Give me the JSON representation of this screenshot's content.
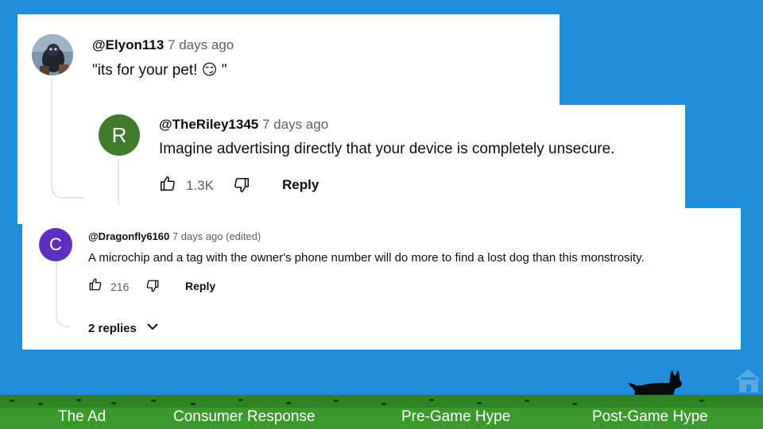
{
  "comments": [
    {
      "handle": "@Elyon113",
      "time": "7 days ago",
      "text": "\"its for your pet! 😏 \""
    },
    {
      "avatar_letter": "R",
      "avatar_color": "#3e7d2a",
      "handle": "@TheRiley1345",
      "time": "7 days ago",
      "text": "Imagine advertising directly that your device is completely unsecure.",
      "likes": "1.3K",
      "reply_label": "Reply"
    },
    {
      "avatar_letter": "C",
      "avatar_color": "#5b2fbf",
      "handle": "@Dragonfly6160",
      "time": "7 days ago (edited)",
      "text": "A microchip and a tag with the owner's phone number will do more to find a lost dog than this monstrosity.",
      "likes": "216",
      "reply_label": "Reply",
      "replies_label": "2 replies"
    }
  ],
  "nav": {
    "items": [
      "The Ad",
      "Consumer Response",
      "Pre-Game Hype",
      "Post-Game Hype"
    ]
  },
  "colors": {
    "background": "#1f8ed8",
    "grass": "#3c9a2c",
    "home_icon": "#5aa8e0"
  },
  "icons": [
    "thumbs-up-icon",
    "thumbs-down-icon",
    "chevron-down-icon",
    "home-icon",
    "dog-silhouette-icon"
  ]
}
